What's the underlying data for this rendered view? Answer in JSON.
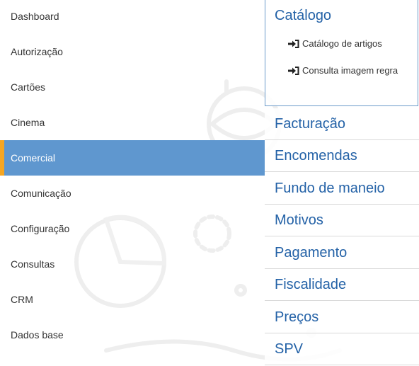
{
  "sidebar": {
    "items": [
      {
        "label": "Dashboard"
      },
      {
        "label": "Autorização"
      },
      {
        "label": "Cartões"
      },
      {
        "label": "Cinema"
      },
      {
        "label": "Comercial",
        "active": true
      },
      {
        "label": "Comunicação"
      },
      {
        "label": "Configuração"
      },
      {
        "label": "Consultas"
      },
      {
        "label": "CRM"
      },
      {
        "label": "Dados base"
      }
    ]
  },
  "panel": {
    "catalog": {
      "title": "Catálogo",
      "links": [
        {
          "label": "Catálogo de artigos",
          "icon": "sign-in-icon"
        },
        {
          "label": "Consulta imagem regra",
          "icon": "sign-in-icon"
        }
      ]
    },
    "sections": [
      {
        "label": "Facturação"
      },
      {
        "label": "Encomendas"
      },
      {
        "label": "Fundo de maneio"
      },
      {
        "label": "Motivos"
      },
      {
        "label": "Pagamento"
      },
      {
        "label": "Fiscalidade"
      },
      {
        "label": "Preços"
      },
      {
        "label": "SPV"
      }
    ]
  },
  "colors": {
    "accent": "#2462a7",
    "active_bg": "#5f97cf",
    "active_marker": "#f5a623"
  }
}
